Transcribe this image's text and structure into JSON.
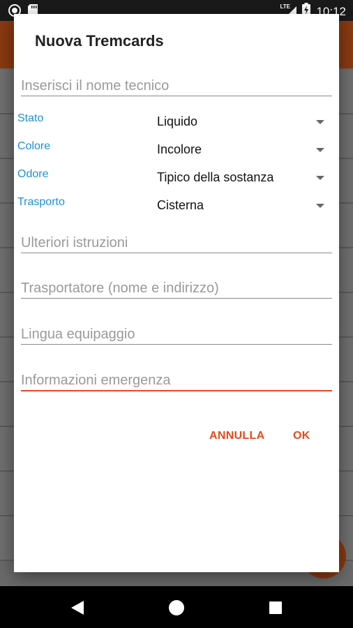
{
  "status_bar": {
    "time": "10:12",
    "network": "LTE",
    "icons": [
      "record-icon",
      "sd-card-icon",
      "lte-signal-icon",
      "battery-charging-icon"
    ]
  },
  "dialog": {
    "title": "Nuova Tremcards",
    "name_input": {
      "placeholder": "Inserisci il nome tecnico"
    },
    "spinners": [
      {
        "label": "Stato",
        "value": "Liquido"
      },
      {
        "label": "Colore",
        "value": "Incolore"
      },
      {
        "label": "Odore",
        "value": "Tipico della sostanza"
      },
      {
        "label": "Trasporto",
        "value": "Cisterna"
      }
    ],
    "further_instructions": {
      "placeholder": "Ulteriori istruzioni"
    },
    "carrier": {
      "placeholder": "Trasportatore (nome e indirizzo)"
    },
    "crew_language": {
      "placeholder": "Lingua equipaggio"
    },
    "emergency_info": {
      "placeholder": "Informazioni emergenza"
    },
    "cancel_label": "ANNULLA",
    "ok_label": "OK"
  },
  "colors": {
    "accent": "#e64a19",
    "label_blue": "#1f8fd6",
    "toolbar_dimmed": "#8a3a10"
  },
  "nav_bar": {
    "icons": [
      "back-icon",
      "home-icon",
      "recents-icon"
    ]
  }
}
